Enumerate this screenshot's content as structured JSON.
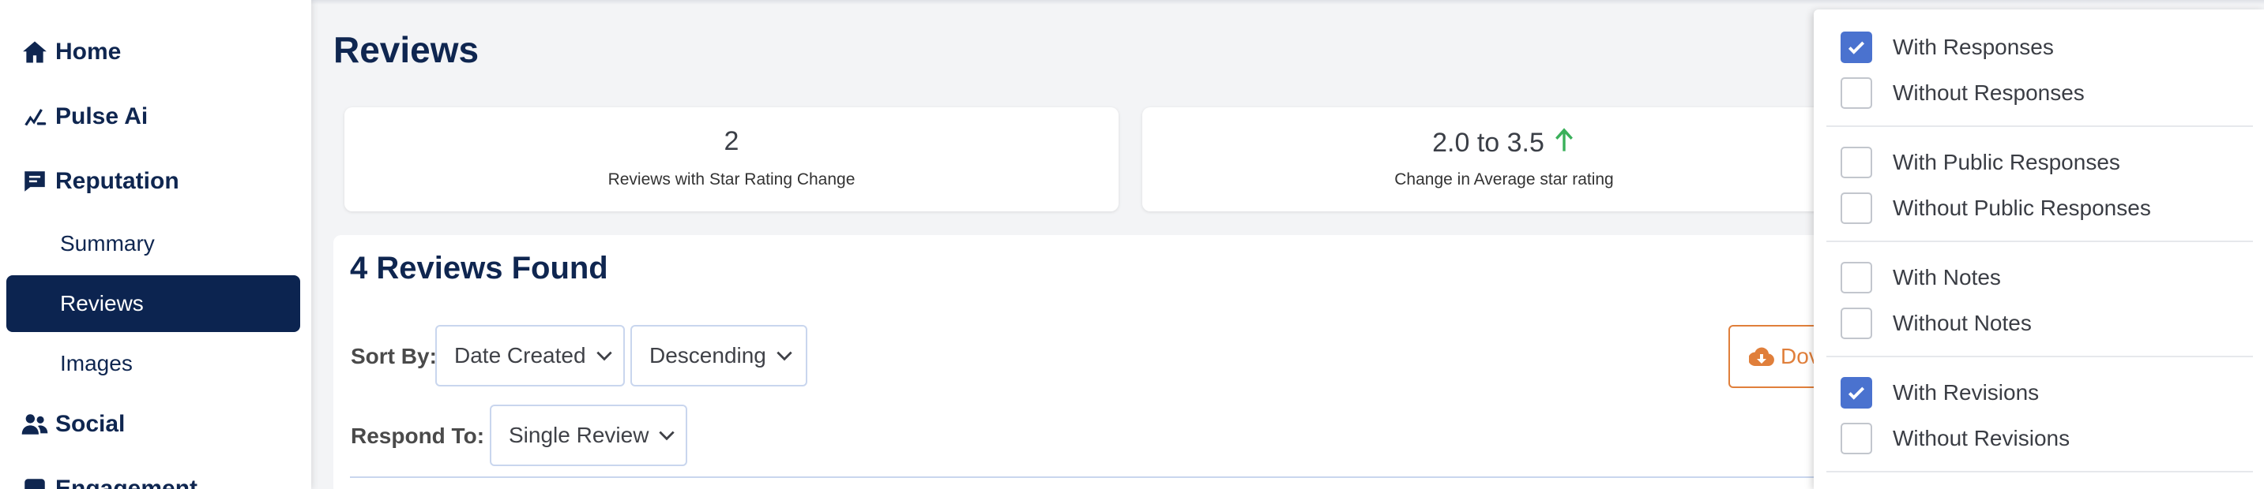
{
  "sidebar": {
    "home": "Home",
    "pulse_ai": "Pulse Ai",
    "reputation": "Reputation",
    "summary": "Summary",
    "reviews": "Reviews",
    "images": "Images",
    "social": "Social",
    "engagement": "Engagement"
  },
  "page": {
    "title": "Reviews"
  },
  "stats": [
    {
      "value": "2",
      "label": "Reviews with Star Rating Change"
    },
    {
      "value": "2.0 to 3.5",
      "label": "Change in Average star rating"
    }
  ],
  "results": {
    "title": "4 Reviews Found",
    "sort_by_label": "Sort By:",
    "sort_field": "Date Created",
    "sort_order": "Descending",
    "respond_to_label": "Respond To:",
    "respond_to": "Single Review",
    "download_label": "Dov"
  },
  "filters": {
    "with_responses": {
      "label": "With Responses",
      "checked": true
    },
    "without_responses": {
      "label": "Without Responses",
      "checked": false
    },
    "with_public_responses": {
      "label": "With Public Responses",
      "checked": false
    },
    "without_public_responses": {
      "label": "Without Public Responses",
      "checked": false
    },
    "with_notes": {
      "label": "With Notes",
      "checked": false
    },
    "without_notes": {
      "label": "Without Notes",
      "checked": false
    },
    "with_revisions": {
      "label": "With Revisions",
      "checked": true
    },
    "without_revisions": {
      "label": "Without Revisions",
      "checked": false
    }
  },
  "colors": {
    "navy": "#0f2650",
    "active_bg": "#0c2450",
    "check_blue": "#4a72cf",
    "up_green": "#3ab05a",
    "download_orange": "#e07f3b"
  },
  "icons": {
    "home": "home-icon",
    "pulse_ai": "pulse-ai-icon",
    "reputation": "chat-bubble-icon",
    "social": "users-icon",
    "engagement": "engagement-icon",
    "stat_trend": "arrow-up-icon",
    "download": "cloud-download-icon",
    "select": "chevron-down-icon",
    "checkbox": "check-icon"
  }
}
